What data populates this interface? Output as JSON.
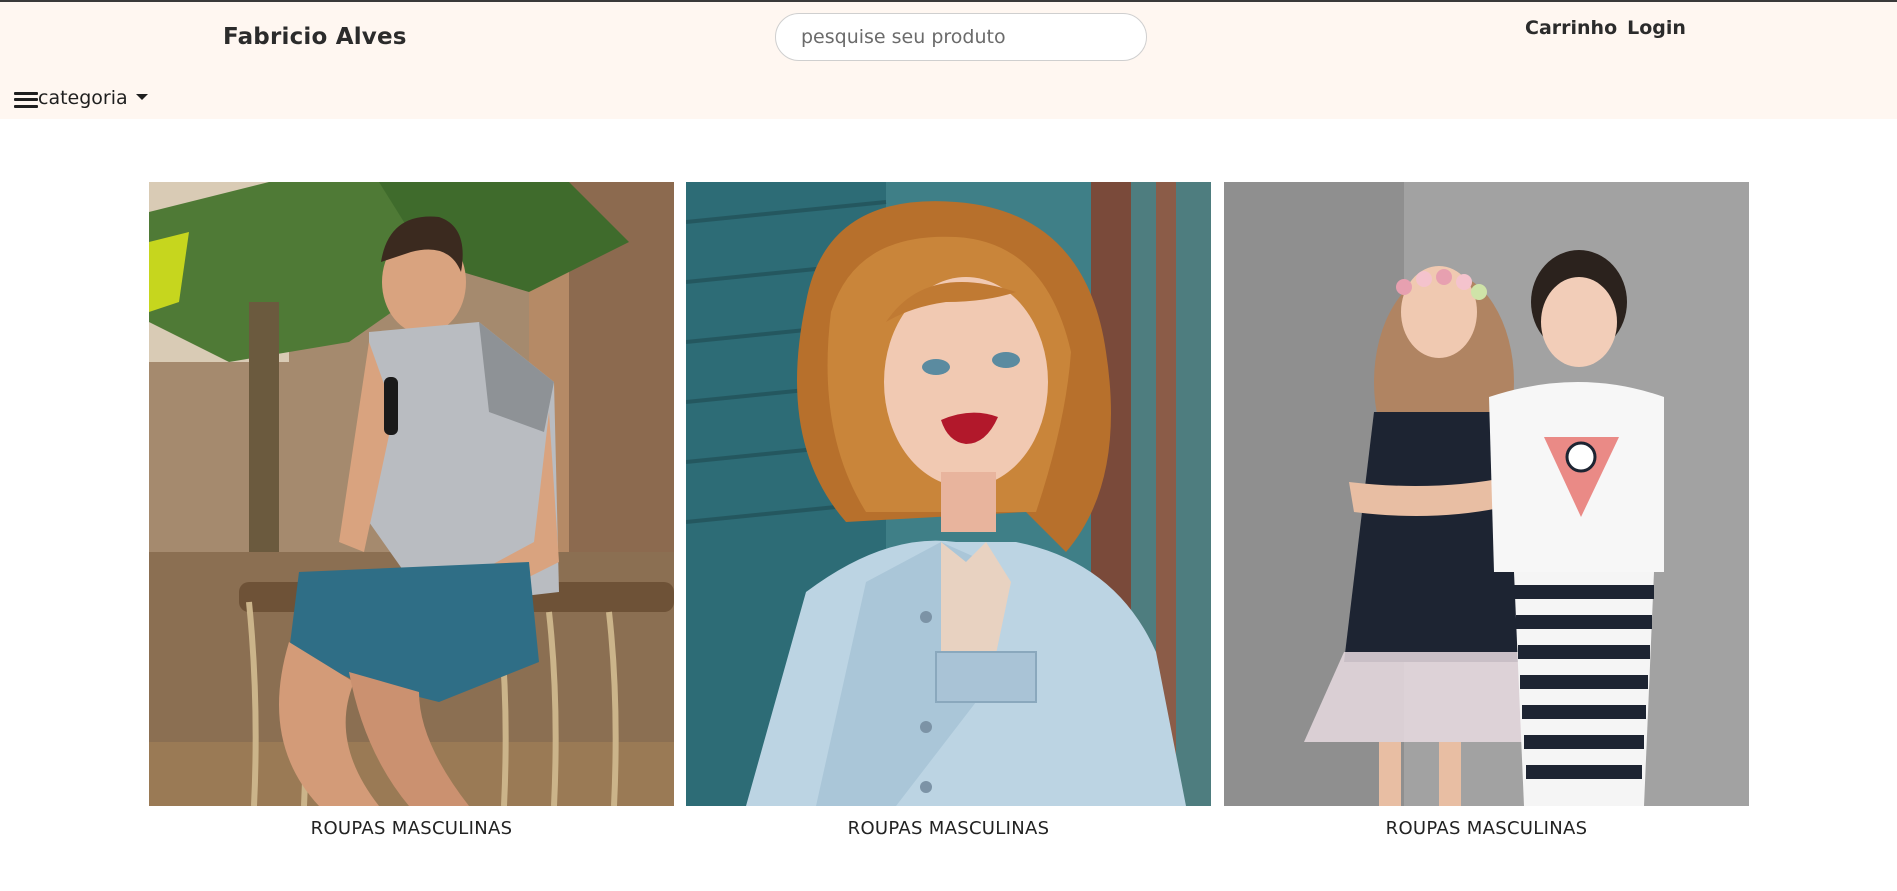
{
  "header": {
    "brand": "Fabricio Alves",
    "search_placeholder": "pesquise seu produto",
    "cart_label": "Carrinho",
    "login_label": "Login",
    "category_label": "categoria"
  },
  "products": [
    {
      "caption": "ROUPAS MASCULINAS",
      "image": "man-gray-tshirt-photo"
    },
    {
      "caption": "ROUPAS MASCULINAS",
      "image": "woman-denim-jacket-photo"
    },
    {
      "caption": "ROUPAS MASCULINAS",
      "image": "children-nautical-outfits-photo"
    }
  ],
  "colors": {
    "header_bg": "#fff7f1",
    "text": "#2b2b2b"
  }
}
